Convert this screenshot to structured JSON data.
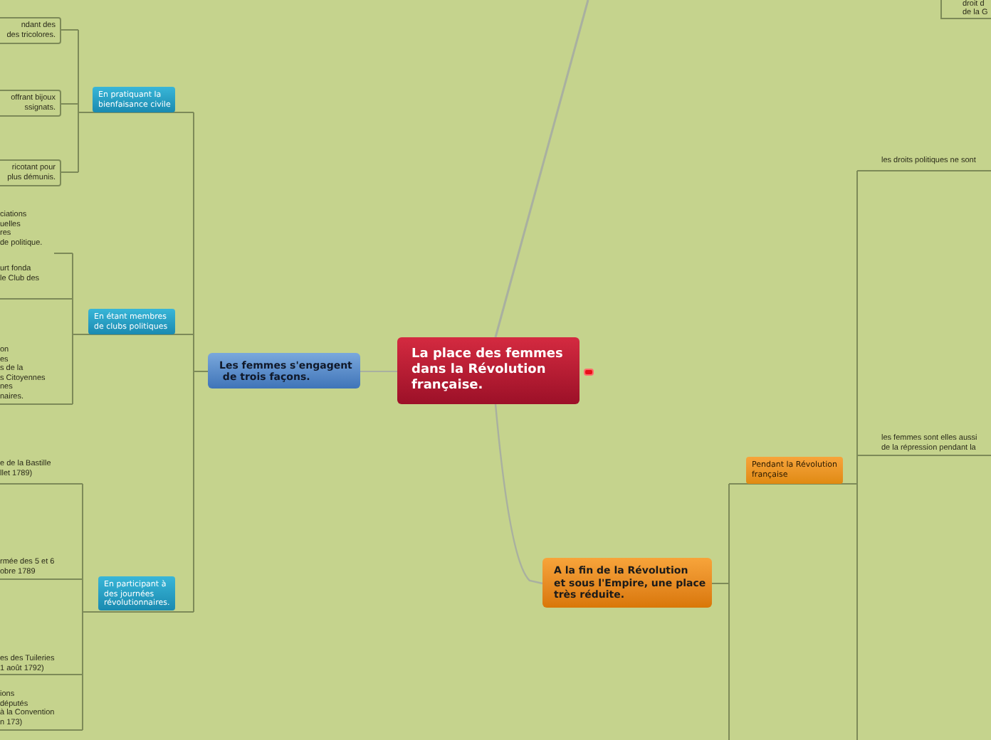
{
  "central_topic": {
    "lines": [
      "La place des femmes",
      "dans la Révolution",
      "française."
    ]
  },
  "branches": [
    {
      "lines": [
        "Les femmes s'engagent",
        " de trois façons."
      ],
      "children": [
        {
          "lines": [
            "En pratiquant la",
            "bienfaisance civile"
          ],
          "children": [
            {
              "lines": [
                "ndant des",
                "des tricolores."
              ]
            },
            {
              "lines": [
                "offrant bijoux",
                "ssignats."
              ]
            },
            {
              "lines": [
                "ricotant pour",
                "plus démunis."
              ]
            }
          ]
        },
        {
          "lines": [
            "En étant membres",
            "de clubs politiques"
          ],
          "children": [
            {
              "lines": [
                "ciations",
                "uelles",
                "res",
                "de politique."
              ]
            },
            {
              "lines": [
                "urt fonda",
                "le Club des"
              ]
            },
            {
              "lines": [
                "on",
                "es",
                "s de la",
                "s Citoyennes",
                "nes",
                "naires."
              ]
            }
          ]
        },
        {
          "lines": [
            "En participant à",
            "des journées",
            "révolutionnaires."
          ],
          "children": [
            {
              "lines": [
                "e de la Bastille",
                "llet 1789)"
              ]
            },
            {
              "lines": [
                "rmée des 5 et 6",
                "obre 1789"
              ]
            },
            {
              "lines": [
                "es des Tuileries",
                "1 août 1792)"
              ]
            },
            {
              "lines": [
                "ions",
                "députés",
                "à la Convention",
                "n 173)"
              ]
            }
          ]
        }
      ]
    },
    {
      "lines": [
        "A la fin de la Révolution",
        "et sous l'Empire, une place",
        "très réduite."
      ],
      "children": [
        {
          "lines": [
            "Pendant la Révolution",
            "française"
          ],
          "children": [
            {
              "lines": [
                "les droits politiques ne sont"
              ]
            },
            {
              "lines": [
                "les femmes sont elles aussi",
                "de la répression pendant la"
              ]
            }
          ]
        }
      ]
    }
  ],
  "offscreen_topic": {
    "lines": [
      "droit d",
      "de la G"
    ]
  }
}
